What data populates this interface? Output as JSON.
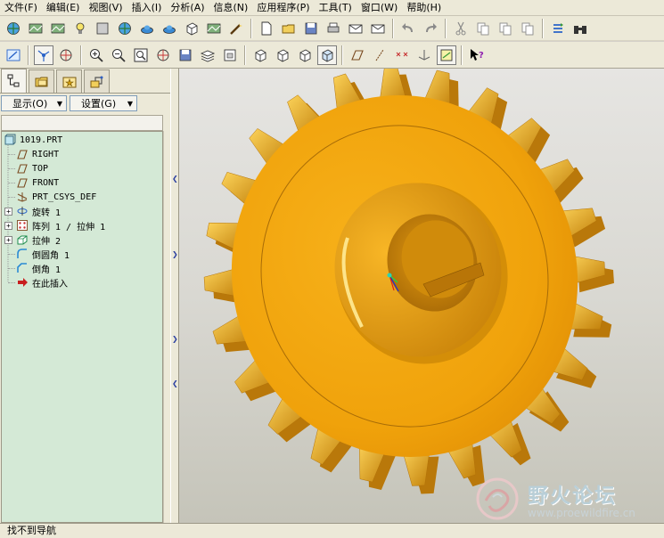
{
  "menubar": {
    "items": [
      "文件(F)",
      "编辑(E)",
      "视图(V)",
      "插入(I)",
      "分析(A)",
      "信息(N)",
      "应用程序(P)",
      "工具(T)",
      "窗口(W)",
      "帮助(H)"
    ]
  },
  "toolbar1": {
    "icons": [
      "color-appearance-icon",
      "scene-icon",
      "texture-icon",
      "light-icon",
      "model-setup-icon",
      "globe-icon",
      "teapot-icon",
      "saucer-icon",
      "cube-export-icon",
      "render-room-icon",
      "magic-wand-icon",
      "new-file-icon",
      "open-folder-icon",
      "save-icon",
      "print-icon",
      "email-icon",
      "email-attach-icon",
      "undo-icon",
      "redo-icon",
      "cut-icon",
      "copy-icon",
      "paste-icon",
      "paste-special-icon",
      "regenerate-icon",
      "binoculars-icon"
    ]
  },
  "toolbar2": {
    "icons": [
      "repaint-icon",
      "spin-center-icon",
      "orient-icon",
      "zoom-in-icon",
      "zoom-out-icon",
      "refit-icon",
      "reorient-icon",
      "saved-views-icon",
      "layers-icon",
      "view-manager-icon",
      "wireframe-icon",
      "hidden-line-icon",
      "no-hidden-icon",
      "shading-icon",
      "datum-planes-icon",
      "datum-axes-icon",
      "datum-points-icon",
      "csys-icon",
      "annotation-icon",
      "whats-this-icon"
    ]
  },
  "navigator": {
    "tabs": [
      "model-tree-tab",
      "folder-tab",
      "favorites-tab",
      "connections-tab"
    ],
    "show_label": "显示(O)",
    "settings_label": "设置(G)"
  },
  "model_tree": {
    "root": "1019.PRT",
    "items": [
      {
        "label": "RIGHT",
        "icon": "datum-plane-icon",
        "expandable": false
      },
      {
        "label": "TOP",
        "icon": "datum-plane-icon",
        "expandable": false
      },
      {
        "label": "FRONT",
        "icon": "datum-plane-icon",
        "expandable": false
      },
      {
        "label": "PRT_CSYS_DEF",
        "icon": "csys-icon",
        "expandable": false
      },
      {
        "label": "旋转 1",
        "icon": "revolve-icon",
        "expandable": true
      },
      {
        "label": "阵列 1 / 拉伸 1",
        "icon": "pattern-icon",
        "expandable": true
      },
      {
        "label": "拉伸 2",
        "icon": "extrude-icon",
        "expandable": true
      },
      {
        "label": "倒圆角 1",
        "icon": "round-icon",
        "expandable": false
      },
      {
        "label": "倒角 1",
        "icon": "chamfer-icon",
        "expandable": false
      },
      {
        "label": "在此插入",
        "icon": "insert-here-arrow-icon",
        "expandable": false
      }
    ]
  },
  "model": {
    "teeth": 24,
    "gear_color": "#f2a30c",
    "shadow_color": "#b9780a"
  },
  "watermark": {
    "title": "野火论坛",
    "url": "www.proewildfire.cn"
  },
  "statusbar": {
    "text": "找不到导航"
  }
}
